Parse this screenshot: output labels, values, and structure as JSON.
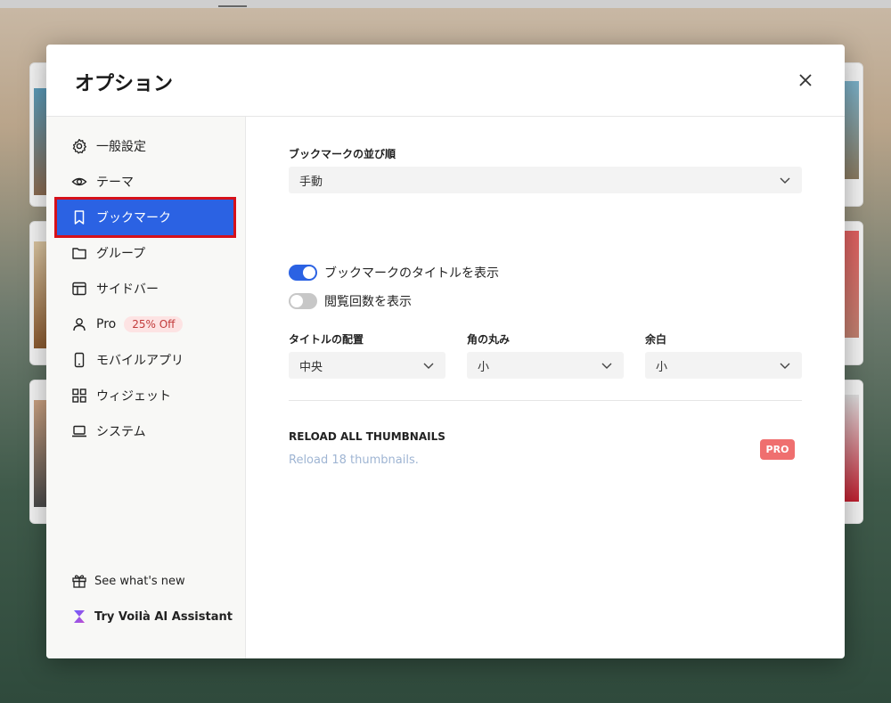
{
  "modal": {
    "title": "オプション"
  },
  "sidebar": {
    "items": [
      {
        "label": "一般設定",
        "icon": "gear-icon"
      },
      {
        "label": "テーマ",
        "icon": "eye-icon"
      },
      {
        "label": "ブックマーク",
        "icon": "bookmark-icon"
      },
      {
        "label": "グループ",
        "icon": "folder-icon"
      },
      {
        "label": "サイドバー",
        "icon": "sidebar-layout-icon"
      },
      {
        "label": "Pro",
        "icon": "user-icon",
        "badge": "25% Off"
      },
      {
        "label": "モバイルアプリ",
        "icon": "mobile-icon"
      },
      {
        "label": "ウィジェット",
        "icon": "widget-grid-icon"
      },
      {
        "label": "システム",
        "icon": "laptop-icon"
      }
    ],
    "footer": [
      {
        "label": "See what's new",
        "icon": "gift-icon"
      },
      {
        "label": "Try Voilà AI Assistant",
        "icon": "hourglass-logo-icon"
      }
    ]
  },
  "content": {
    "sort_label": "ブックマークの並び順",
    "sort_value": "手動",
    "toggles": [
      {
        "label": "ブックマークのタイトルを表示",
        "on": true
      },
      {
        "label": "閲覧回数を表示",
        "on": false
      }
    ],
    "title_align_label": "タイトルの配置",
    "title_align_value": "中央",
    "corner_label": "角の丸み",
    "corner_value": "小",
    "margin_label": "余白",
    "margin_value": "小",
    "reload_title": "RELOAD ALL THUMBNAILS",
    "reload_sub": "Reload 18 thumbnails.",
    "pro_badge": "PRO"
  },
  "colors": {
    "accent": "#2b62e3",
    "highlight_border": "#d6111a",
    "pro_badge": "#ef6f6f",
    "badge_bg": "#fde3e3"
  }
}
